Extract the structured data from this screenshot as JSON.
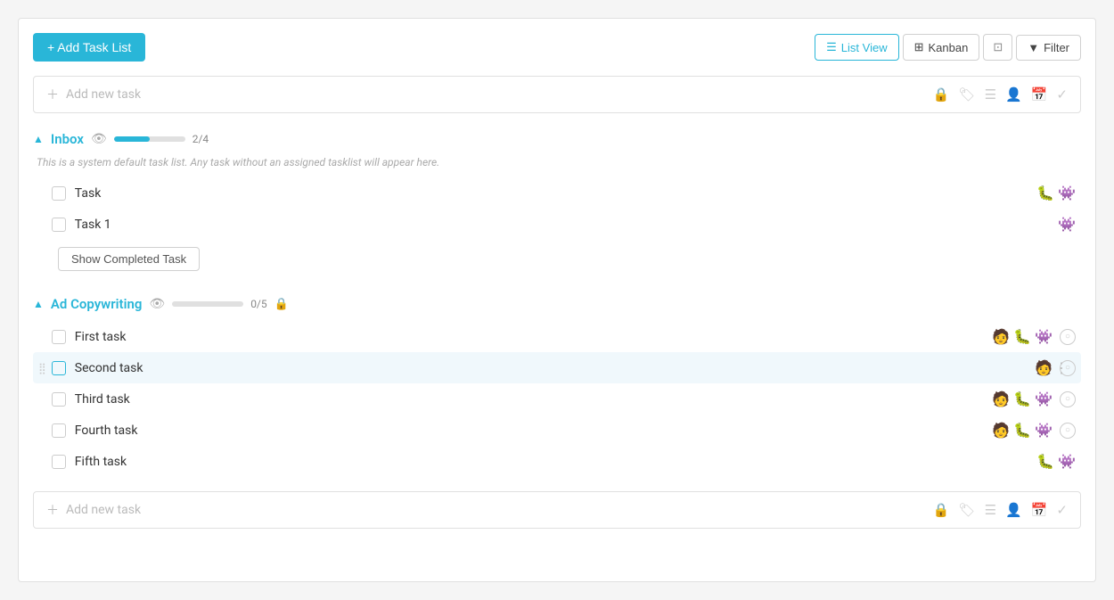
{
  "toolbar": {
    "add_task_list_label": "+ Add Task List",
    "list_view_label": "List View",
    "kanban_label": "Kanban",
    "filter_label": "Filter"
  },
  "add_task_bar_top": {
    "placeholder": "Add new task"
  },
  "add_task_bar_bottom": {
    "placeholder": "Add new task"
  },
  "inbox": {
    "title": "Inbox",
    "description": "This is a system default task list. Any task without an assigned tasklist will appear here.",
    "progress_percent": 50,
    "progress_label": "2/4",
    "tasks": [
      {
        "name": "Task",
        "emojis": [
          "🐛",
          "👾"
        ]
      },
      {
        "name": "Task 1",
        "emojis": [
          "👾"
        ]
      }
    ],
    "show_completed_label": "Show Completed Task"
  },
  "ad_copywriting": {
    "title": "Ad Copywriting",
    "progress_percent": 0,
    "progress_label": "0/5",
    "tasks": [
      {
        "name": "First task",
        "emojis": [
          "🧑",
          "🐛",
          "👾"
        ],
        "has_clock": true
      },
      {
        "name": "Second task",
        "emojis": [
          "🧑"
        ],
        "has_clock": true,
        "hovered": true
      },
      {
        "name": "Third task",
        "emojis": [
          "🧑",
          "🐛",
          "👾"
        ],
        "has_clock": true
      },
      {
        "name": "Fourth task",
        "emojis": [
          "🧑",
          "🐛",
          "👾"
        ],
        "has_clock": true
      },
      {
        "name": "Fifth task",
        "emojis": [
          "🐛",
          "👾"
        ],
        "has_clock": false
      }
    ]
  }
}
